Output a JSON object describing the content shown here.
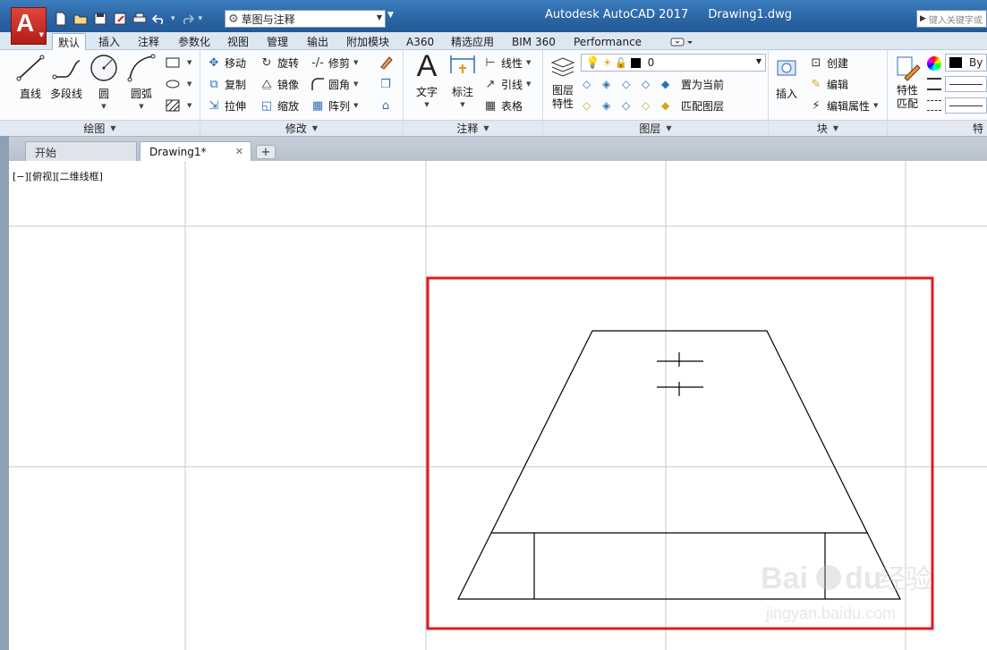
{
  "titlebar": {
    "app_menu_letter": "A",
    "workspace": "草图与注释",
    "app_name": "Autodesk AutoCAD 2017",
    "file_name": "Drawing1.dwg",
    "search_placeholder": "键入关键字或"
  },
  "ribbon_tabs": [
    "默认",
    "插入",
    "注释",
    "参数化",
    "视图",
    "管理",
    "输出",
    "附加模块",
    "A360",
    "精选应用",
    "BIM 360",
    "Performance"
  ],
  "panels": {
    "draw": {
      "title": "绘图",
      "line": "直线",
      "polyline": "多段线",
      "circle": "圆",
      "arc": "圆弧"
    },
    "modify": {
      "title": "修改",
      "move": "移动",
      "rotate": "旋转",
      "trim": "修剪",
      "copy": "复制",
      "mirror": "镜像",
      "fillet": "圆角",
      "stretch": "拉伸",
      "scale": "缩放",
      "array": "阵列"
    },
    "annotation": {
      "title": "注释",
      "text": "文字",
      "dimension": "标注",
      "linear": "线性",
      "leader": "引线",
      "table": "表格"
    },
    "layers": {
      "title": "图层",
      "layer_properties": "图层\n特性",
      "current_layer": "0",
      "set_current": "置为当前",
      "match_layer": "匹配图层"
    },
    "block": {
      "title": "块",
      "insert": "插入",
      "create": "创建",
      "edit": "编辑",
      "edit_attributes": "编辑属性"
    },
    "properties": {
      "title": "特",
      "match_properties": "特性\n匹配",
      "color_value": "By"
    }
  },
  "doc_tabs": {
    "start": "开始",
    "drawing": "Drawing1*",
    "plus": "+"
  },
  "viewport_label": "[−][俯视][二维线框]",
  "watermark": "Bai du 经验  jingyan.baidu.com",
  "colors": {
    "titlebar": "#2a64a3",
    "app_button": "#c8261f",
    "highlight_box": "#e01b1b"
  }
}
